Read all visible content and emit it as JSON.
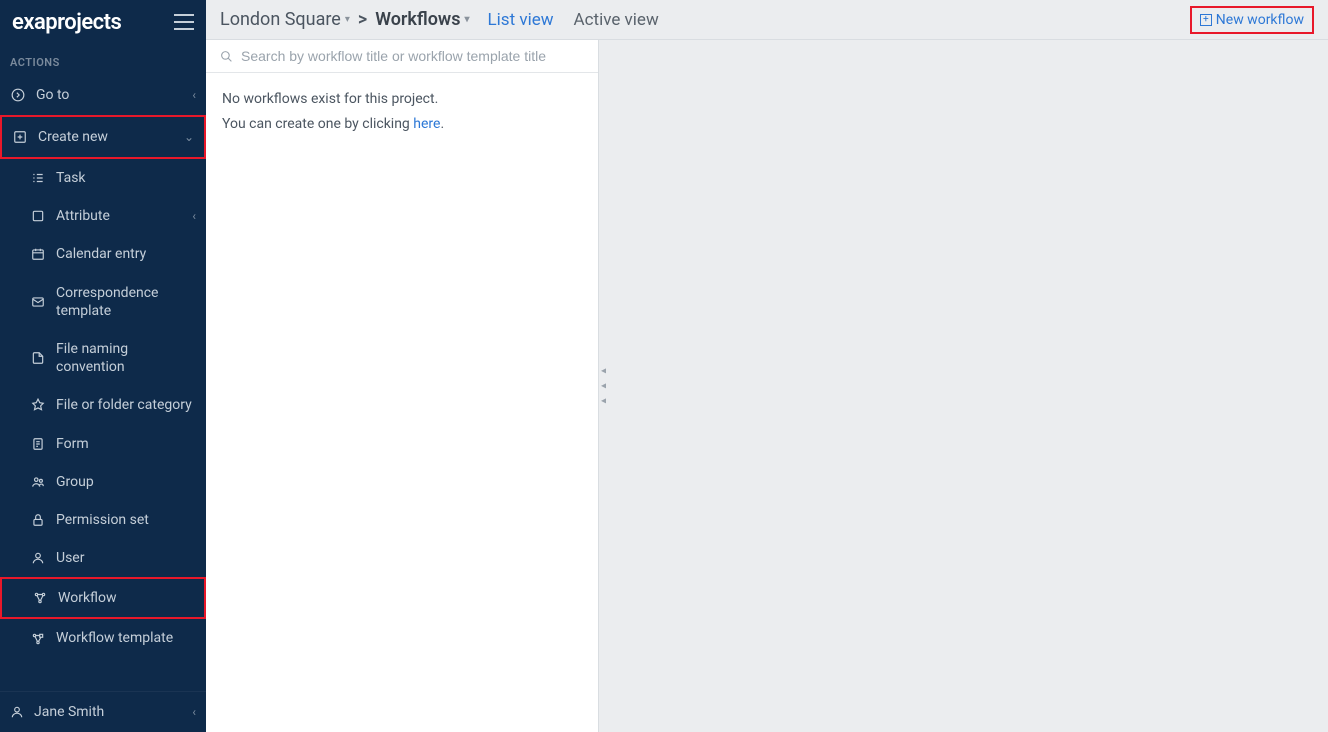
{
  "logo": "exaprojects",
  "sidebar": {
    "section_label": "ACTIONS",
    "goto": "Go to",
    "create_new": "Create new",
    "items": [
      "Task",
      "Attribute",
      "Calendar entry",
      "Correspondence template",
      "File naming convention",
      "File or folder category",
      "Form",
      "Group",
      "Permission set",
      "User",
      "Workflow",
      "Workflow template"
    ],
    "user": "Jane Smith"
  },
  "breadcrumb": {
    "project": "London Square",
    "section": "Workflows",
    "list_view": "List view",
    "active_view": "Active view"
  },
  "new_workflow_btn": "New workflow",
  "search": {
    "placeholder": "Search by workflow title or workflow template title"
  },
  "empty": {
    "line1": "No workflows exist for this project.",
    "line2_prefix": "You can create one by clicking ",
    "line2_link": "here"
  }
}
